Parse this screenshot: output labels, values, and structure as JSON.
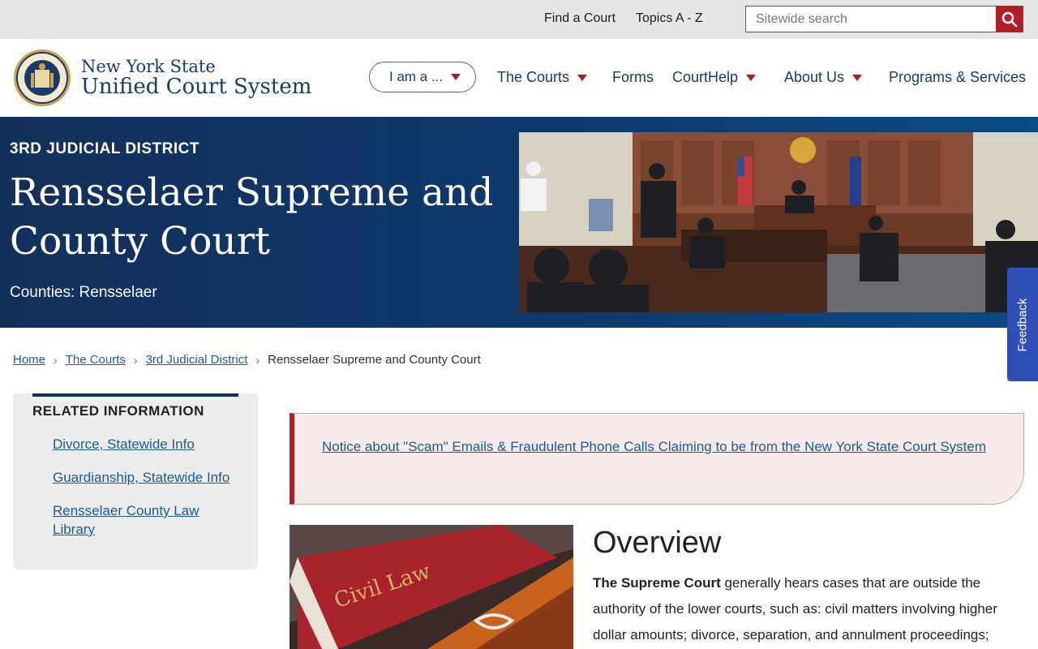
{
  "utility": {
    "find_court": "Find a Court",
    "topics": "Topics A - Z",
    "search_placeholder": "Sitewide search"
  },
  "header": {
    "brand_line1": "New York State",
    "brand_line2": "Unified Court System",
    "nav": {
      "i_am": "I am a ...",
      "courts": "The Courts",
      "forms": "Forms",
      "courthelp": "CourtHelp",
      "about": "About Us",
      "programs": "Programs & Services"
    }
  },
  "hero": {
    "kicker": "3RD JUDICIAL DISTRICT",
    "title": "Rensselaer Supreme and County Court",
    "counties": "Counties: Rensselaer"
  },
  "feedback": "Feedback",
  "breadcrumb": {
    "home": "Home",
    "courts": "The Courts",
    "district": "3rd Judicial District",
    "current": "Rensselaer Supreme and County Court"
  },
  "sidebar": {
    "title": "RELATED INFORMATION",
    "links": [
      "Divorce, Statewide Info",
      "Guardianship, Statewide Info",
      "Rensselaer County Law Library"
    ]
  },
  "notice": "Notice about \"Scam\" Emails & Fraudulent Phone Calls Claiming to be from the New York State Court System",
  "overview": {
    "title": "Overview",
    "lead": "The Supreme Court",
    "text": " generally hears cases that are outside the authority of the lower courts, such as: civil matters involving higher dollar amounts; divorce, separation, and annulment proceedings;",
    "image_label": "Civil Law"
  },
  "colors": {
    "navy": "#12305c",
    "accent_red": "#b01e28",
    "link_blue": "#1d5a9c",
    "feedback_blue": "#2f4fb5"
  }
}
